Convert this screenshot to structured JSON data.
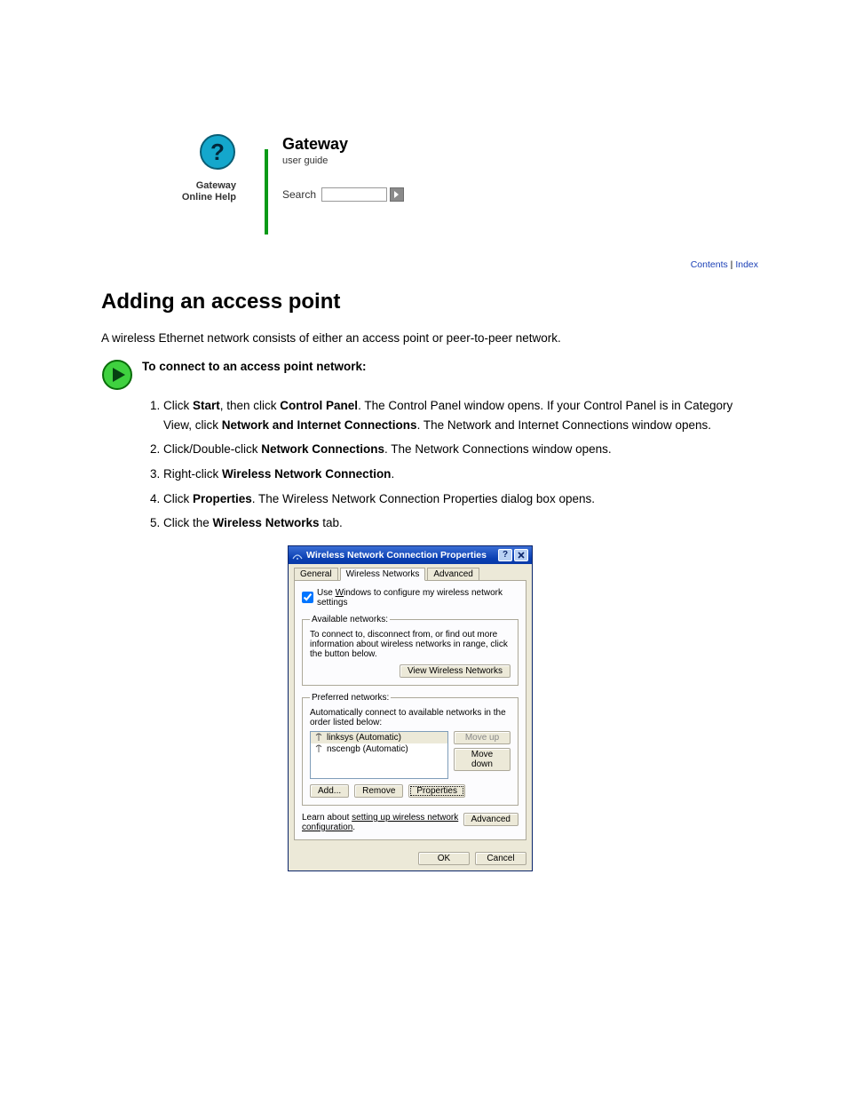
{
  "header": {
    "help_brand_line1": "Gateway",
    "help_brand_line2": "Online Help",
    "brand_title": "Gateway",
    "brand_sub": "user guide",
    "search_label": "Search",
    "go_icon_name": "arrow-right-icon"
  },
  "top_links": {
    "contents": "Contents",
    "index": "Index",
    "sep": " | "
  },
  "page": {
    "title": "Adding an access point",
    "intro": "A wireless Ethernet network consists of either an access point or peer-to-peer network.",
    "play_label": "To connect to an access point network:",
    "steps": [
      {
        "pre": "Click ",
        "b1": "Start",
        "mid1": ", then click ",
        "b2": "Control Panel",
        "post": ". The Control Panel window opens. If your Control Panel is in Category View, click ",
        "b3": "Network and Internet Connections",
        "mid2": ". The Network and Internet Connections window opens."
      },
      {
        "pre": "Click/Double-click ",
        "b1": "Network Connections",
        "post": ". The Network Connections window opens."
      },
      {
        "pre": "Right-click ",
        "b1": "Wireless Network Connection",
        "post": "."
      },
      {
        "pre": "Click ",
        "b1": "Properties",
        "post": ". The Wireless Network Connection Properties dialog box opens."
      },
      {
        "pre": "Click the ",
        "b1": "Wireless Networks",
        "post": " tab."
      }
    ]
  },
  "dialog": {
    "title": "Wireless Network Connection Properties",
    "tabs": {
      "general": "General",
      "wireless": "Wireless Networks",
      "advanced": "Advanced"
    },
    "checkbox_label_pre": "Use ",
    "checkbox_label_ul": "W",
    "checkbox_label_post": "indows to configure my wireless network settings",
    "avail_legend": "Available networks:",
    "avail_text": "To connect to, disconnect from, or find out more information about wireless networks in range, click the button below.",
    "view_btn": "View Wireless Networks",
    "pref_legend": "Preferred networks:",
    "pref_text": "Automatically connect to available networks in the order listed below:",
    "networks": [
      {
        "name": "linksys (Automatic)",
        "selected": true
      },
      {
        "name": "nscengb (Automatic)",
        "selected": false
      }
    ],
    "move_up": "Move up",
    "move_down": "Move down",
    "add": "Add...",
    "remove": "Remove",
    "properties": "Properties",
    "learn_pre": "Learn about ",
    "learn_link": "setting up wireless network configuration",
    "learn_post": ".",
    "advanced_btn": "Advanced",
    "ok": "OK",
    "cancel": "Cancel"
  }
}
